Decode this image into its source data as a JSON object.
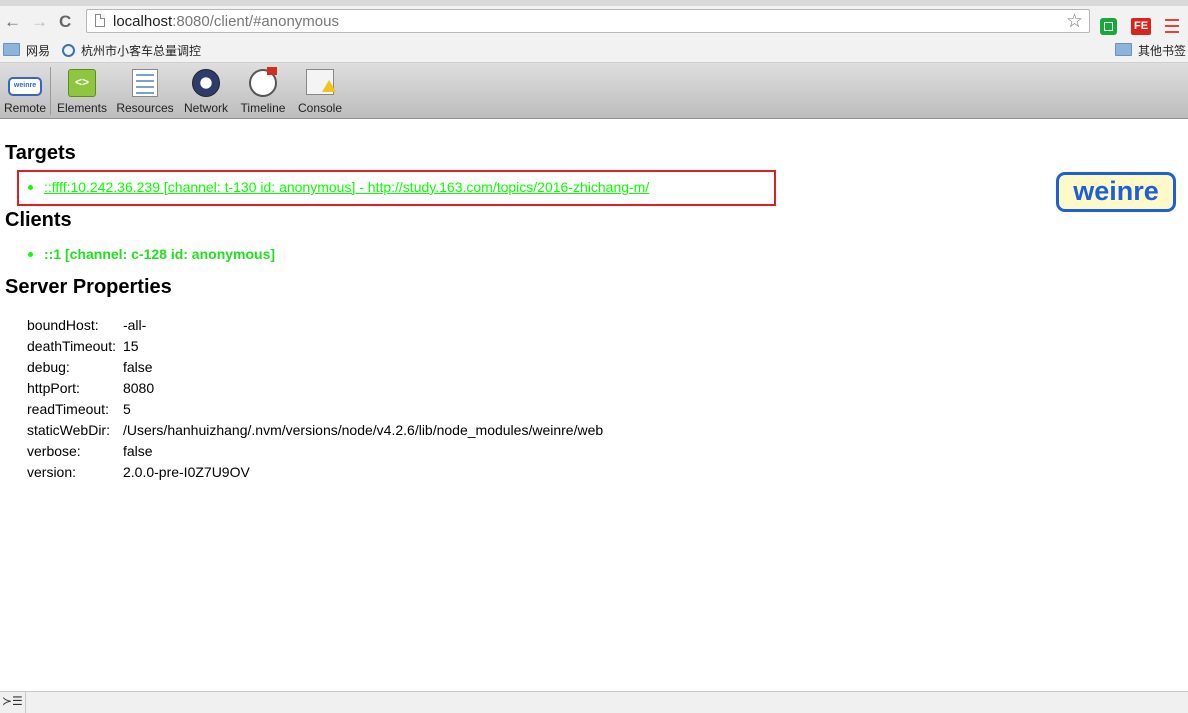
{
  "browser": {
    "url_host": "localhost",
    "url_rest": ":8080/client/#anonymous",
    "back_icon": "←",
    "forward_icon": "→",
    "reload_icon": "C",
    "star_icon": "☆",
    "ext_fe_label": "FE",
    "bookmarks": [
      "网易",
      "杭州市小客车总量调控"
    ],
    "other_bookmarks": "其他书签"
  },
  "toolbar": {
    "remote": "Remote",
    "remote_icon_text": "weinre",
    "elements": "Elements",
    "elements_icon_text": "<>",
    "resources": "Resources",
    "network": "Network",
    "timeline": "Timeline",
    "console": "Console"
  },
  "targets": {
    "heading": "Targets",
    "items": [
      "::ffff:10.242.36.239 [channel: t-130 id: anonymous] - http://study.163.com/topics/2016-zhichang-m/"
    ]
  },
  "clients": {
    "heading": "Clients",
    "items": [
      "::1 [channel: c-128 id: anonymous]"
    ]
  },
  "server_properties": {
    "heading": "Server Properties",
    "rows": [
      {
        "key": "boundHost:",
        "value": "-all-"
      },
      {
        "key": "deathTimeout:",
        "value": "15"
      },
      {
        "key": "debug:",
        "value": "false"
      },
      {
        "key": "httpPort:",
        "value": "8080"
      },
      {
        "key": "readTimeout:",
        "value": "5"
      },
      {
        "key": "staticWebDir:",
        "value": "/Users/hanhuizhang/.nvm/versions/node/v4.2.6/lib/node_modules/weinre/web"
      },
      {
        "key": "verbose:",
        "value": "false"
      },
      {
        "key": "version:",
        "value": "2.0.0-pre-I0Z7U9OV"
      }
    ]
  },
  "logo_text": "weinre",
  "console_prompt": "≻☰",
  "colors": {
    "link_green": "#0aff00",
    "highlight_red": "#e02020",
    "logo_blue": "#1d5fd8"
  }
}
